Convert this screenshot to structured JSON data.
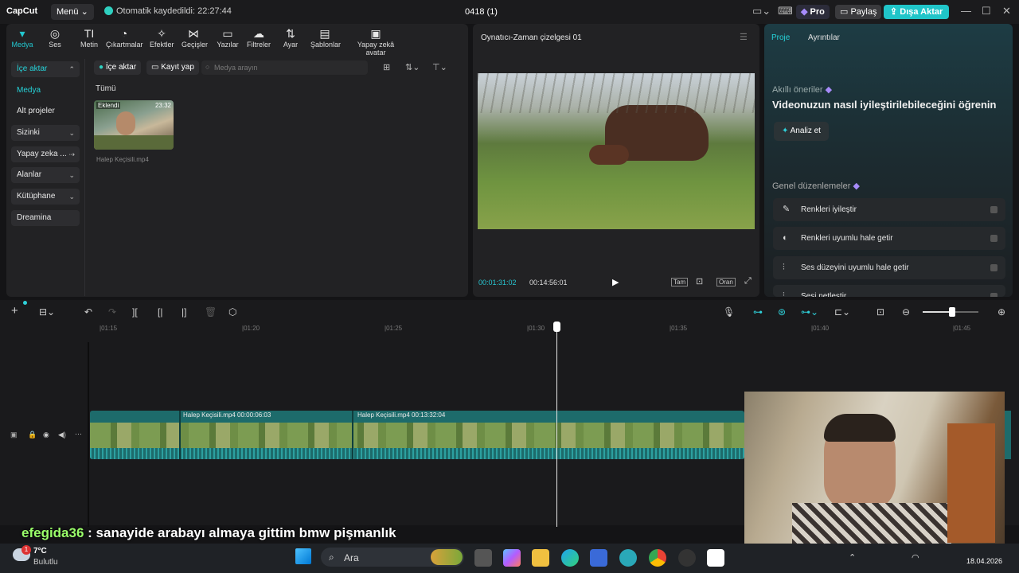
{
  "titlebar": {
    "logo": "CapCut",
    "menu": "Menü ⌄",
    "autosave": "Otomatik kaydedildi: 22:27:44",
    "doc_title": "0418 (1)",
    "pro": "Pro",
    "share": "Paylaş",
    "export": "Dışa Aktar"
  },
  "tools": [
    {
      "label": "Medya",
      "icon": "media-icon"
    },
    {
      "label": "Ses",
      "icon": "audio-icon"
    },
    {
      "label": "Metin",
      "icon": "text-icon"
    },
    {
      "label": "Çıkartmalar",
      "icon": "sticker-icon"
    },
    {
      "label": "Efektler",
      "icon": "effects-icon"
    },
    {
      "label": "Geçişler",
      "icon": "transitions-icon"
    },
    {
      "label": "Yazılar",
      "icon": "captions-icon"
    },
    {
      "label": "Filtreler",
      "icon": "filters-icon"
    },
    {
      "label": "Ayar",
      "icon": "adjust-icon"
    },
    {
      "label": "Şablonlar",
      "icon": "templates-icon"
    },
    {
      "label": "Yapay zekâ avatar",
      "icon": "ai-avatar-icon"
    }
  ],
  "sidebar": {
    "items": [
      {
        "label": "İçe aktar"
      },
      {
        "label": "Medya"
      },
      {
        "label": "Alt projeler"
      },
      {
        "label": "Sizinki"
      },
      {
        "label": "Yapay zeka ..."
      },
      {
        "label": "Alanlar"
      },
      {
        "label": "Kütüphane"
      },
      {
        "label": "Dreamina"
      }
    ]
  },
  "media": {
    "import_btn": "İçe aktar",
    "record_btn": "Kayıt yap",
    "search_placeholder": "Medya arayın",
    "filter_all": "Tümü",
    "clip": {
      "badge": "Eklendi",
      "duration": "23:32",
      "name": "Halep Keçisili.mp4"
    }
  },
  "player": {
    "title": "Oynatıcı-Zaman çizelgesi 01",
    "current_time": "00:01:31:02",
    "total_time": "00:14:56:01",
    "full_btn": "Tam",
    "ratio_btn": "Oran"
  },
  "rightpanel": {
    "tab_project": "Proje",
    "tab_details": "Ayrıntılar",
    "smart_title": "Akıllı öneriler",
    "smart_desc": "Videonuzun nasıl iyileştirilebileceğini öğrenin",
    "analyze_btn": "Analiz et",
    "general_title": "Genel düzenlemeler",
    "rows": [
      {
        "label": "Renkleri iyileştir"
      },
      {
        "label": "Renkleri uyumlu hale getir"
      },
      {
        "label": "Ses düzeyini uyumlu hale getir"
      },
      {
        "label": "Sesi netleştir"
      }
    ]
  },
  "timeline": {
    "ticks": [
      "|01:15",
      "|01:20",
      "|01:25",
      "|01:30",
      "|01:35",
      "|01:40",
      "|01:45"
    ],
    "clip1_label": "Halep Keçisili.mp4   00:00:06:03",
    "clip2_label": "Halep Keçisili.mp4   00:13:32:04"
  },
  "chat": {
    "user": "efegida36",
    "message": " : sanayide arabayı almaya gittim bmw pişmanlık"
  },
  "taskbar": {
    "weather_temp": "7°C",
    "weather_desc": "Bulutlu",
    "search": "Ara",
    "date": "18.04.2026",
    "badge": "1"
  }
}
